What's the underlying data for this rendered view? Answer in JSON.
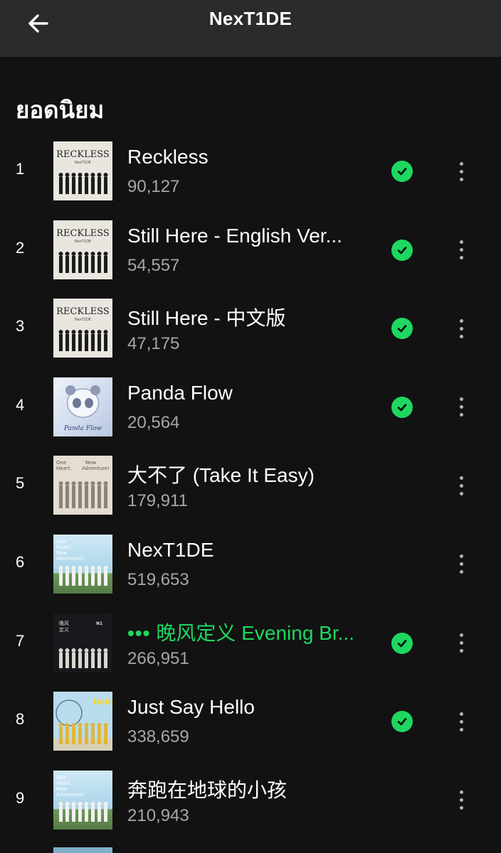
{
  "header": {
    "title": "NexT1DE",
    "back_icon": "arrow-left-icon"
  },
  "section_title": "ยอดนิยม",
  "colors": {
    "accent": "#1ed760",
    "background": "#121212",
    "header_bg": "#2b2b2b",
    "muted_text": "#a7a7a7"
  },
  "tracks": [
    {
      "rank": "1",
      "title": "Reckless",
      "plays": "90,127",
      "saved": true,
      "playing": false,
      "cover": "reckless"
    },
    {
      "rank": "2",
      "title": "Still Here - English Ver...",
      "plays": "54,557",
      "saved": true,
      "playing": false,
      "cover": "reckless"
    },
    {
      "rank": "3",
      "title": "Still Here - 中文版",
      "plays": "47,175",
      "saved": true,
      "playing": false,
      "cover": "reckless"
    },
    {
      "rank": "4",
      "title": "Panda Flow",
      "plays": "20,564",
      "saved": true,
      "playing": false,
      "cover": "panda"
    },
    {
      "rank": "5",
      "title": "大不了 (Take It Easy)",
      "plays": "179,911",
      "saved": false,
      "playing": false,
      "cover": "adventure-beige"
    },
    {
      "rank": "6",
      "title": "NexT1DE",
      "plays": "519,653",
      "saved": false,
      "playing": false,
      "cover": "adventure-blue"
    },
    {
      "rank": "7",
      "title": "晚风定义 Evening Br...",
      "plays": "266,951",
      "saved": true,
      "playing": true,
      "cover": "evening"
    },
    {
      "rank": "8",
      "title": "Just Say Hello",
      "plays": "338,659",
      "saved": true,
      "playing": false,
      "cover": "hello"
    },
    {
      "rank": "9",
      "title": "奔跑在地球的小孩",
      "plays": "210,943",
      "saved": false,
      "playing": false,
      "cover": "adventure-blue"
    }
  ]
}
